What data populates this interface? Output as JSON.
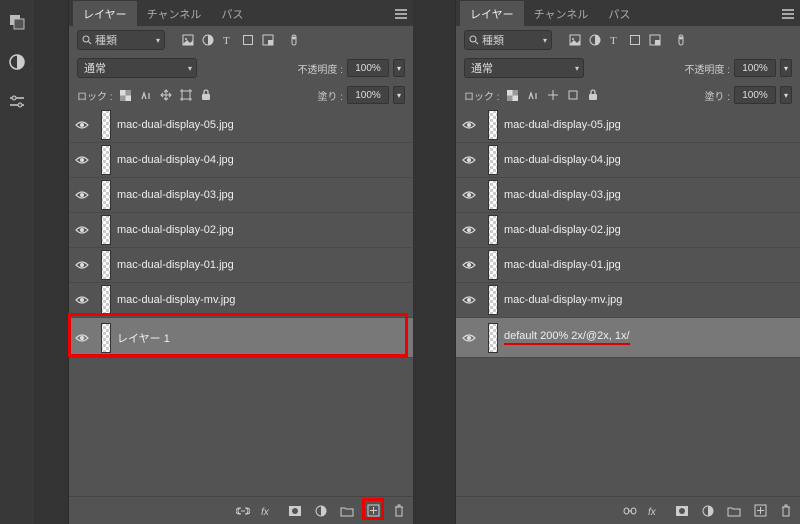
{
  "tabs": {
    "layers": "レイヤー",
    "channels": "チャンネル",
    "paths": "パス"
  },
  "search": {
    "label": "種類"
  },
  "blend": {
    "mode": "通常",
    "opacity_label": "不透明度 :",
    "opacity_value": "100%"
  },
  "lock": {
    "label": "ロック :",
    "fill_label": "塗り :",
    "fill_value": "100%"
  },
  "left_layers": [
    {
      "name": "mac-dual-display-05.jpg",
      "selected": false
    },
    {
      "name": "mac-dual-display-04.jpg",
      "selected": false
    },
    {
      "name": "mac-dual-display-03.jpg",
      "selected": false
    },
    {
      "name": "mac-dual-display-02.jpg",
      "selected": false
    },
    {
      "name": "mac-dual-display-01.jpg",
      "selected": false
    },
    {
      "name": "mac-dual-display-mv.jpg",
      "selected": false
    },
    {
      "name": "レイヤー 1",
      "selected": true
    }
  ],
  "right_layers": [
    {
      "name": "mac-dual-display-05.jpg",
      "selected": false
    },
    {
      "name": "mac-dual-display-04.jpg",
      "selected": false
    },
    {
      "name": "mac-dual-display-03.jpg",
      "selected": false
    },
    {
      "name": "mac-dual-display-02.jpg",
      "selected": false
    },
    {
      "name": "mac-dual-display-01.jpg",
      "selected": false
    },
    {
      "name": "mac-dual-display-mv.jpg",
      "selected": false
    },
    {
      "name": "default 200% 2x/@2x, 1x/",
      "selected": true,
      "underline": true
    }
  ]
}
